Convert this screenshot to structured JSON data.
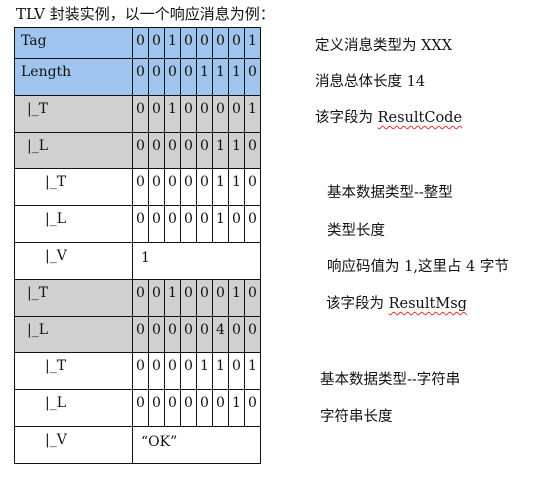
{
  "intro": "TLV 封装实例，以一个响应消息为例：",
  "rows": [
    {
      "name": "Tag",
      "bits": [
        "0",
        "0",
        "1",
        "0",
        "0",
        "0",
        "0",
        "1"
      ],
      "note": "定义消息类型为 XXX"
    },
    {
      "name": "Length",
      "bits": [
        "0",
        "0",
        "0",
        "0",
        "1",
        "1",
        "1",
        "0"
      ],
      "note": "消息总体长度 14"
    },
    {
      "name": "|_T",
      "bits": [
        "0",
        "0",
        "1",
        "0",
        "0",
        "0",
        "0",
        "1"
      ],
      "note_pre": "该字段为 ",
      "note_word": "ResultCode"
    },
    {
      "name": "|_L",
      "bits": [
        "0",
        "0",
        "0",
        "0",
        "0",
        "1",
        "1",
        "0"
      ],
      "note": ""
    },
    {
      "name": "|_T",
      "bits": [
        "0",
        "0",
        "0",
        "0",
        "0",
        "1",
        "1",
        "0"
      ],
      "note": "基本数据类型--整型"
    },
    {
      "name": "|_L",
      "bits": [
        "0",
        "0",
        "0",
        "0",
        "0",
        "1",
        "0",
        "0"
      ],
      "note": "类型长度"
    },
    {
      "name": "|_V",
      "value": "1",
      "note": "响应码值为 1,这里占 4 字节"
    },
    {
      "name": "|_T",
      "bits": [
        "0",
        "0",
        "1",
        "0",
        "0",
        "0",
        "1",
        "0"
      ],
      "note_pre": "该字段为 ",
      "note_word": "ResultMsg"
    },
    {
      "name": "|_L",
      "bits": [
        "0",
        "0",
        "0",
        "0",
        "0",
        "4",
        "0",
        "0"
      ],
      "note": ""
    },
    {
      "name": "|_T",
      "bits": [
        "0",
        "0",
        "0",
        "0",
        "1",
        "1",
        "0",
        "1"
      ],
      "note": "基本数据类型--字符串"
    },
    {
      "name": "|_L",
      "bits": [
        "0",
        "0",
        "0",
        "0",
        "0",
        "0",
        "1",
        "0"
      ],
      "note": "字符串长度"
    },
    {
      "name": "|_V",
      "value": "“OK”",
      "note": ""
    }
  ],
  "colors": {
    "header_blue": "#9fc5ef",
    "group_gray": "#d0d0d0"
  }
}
